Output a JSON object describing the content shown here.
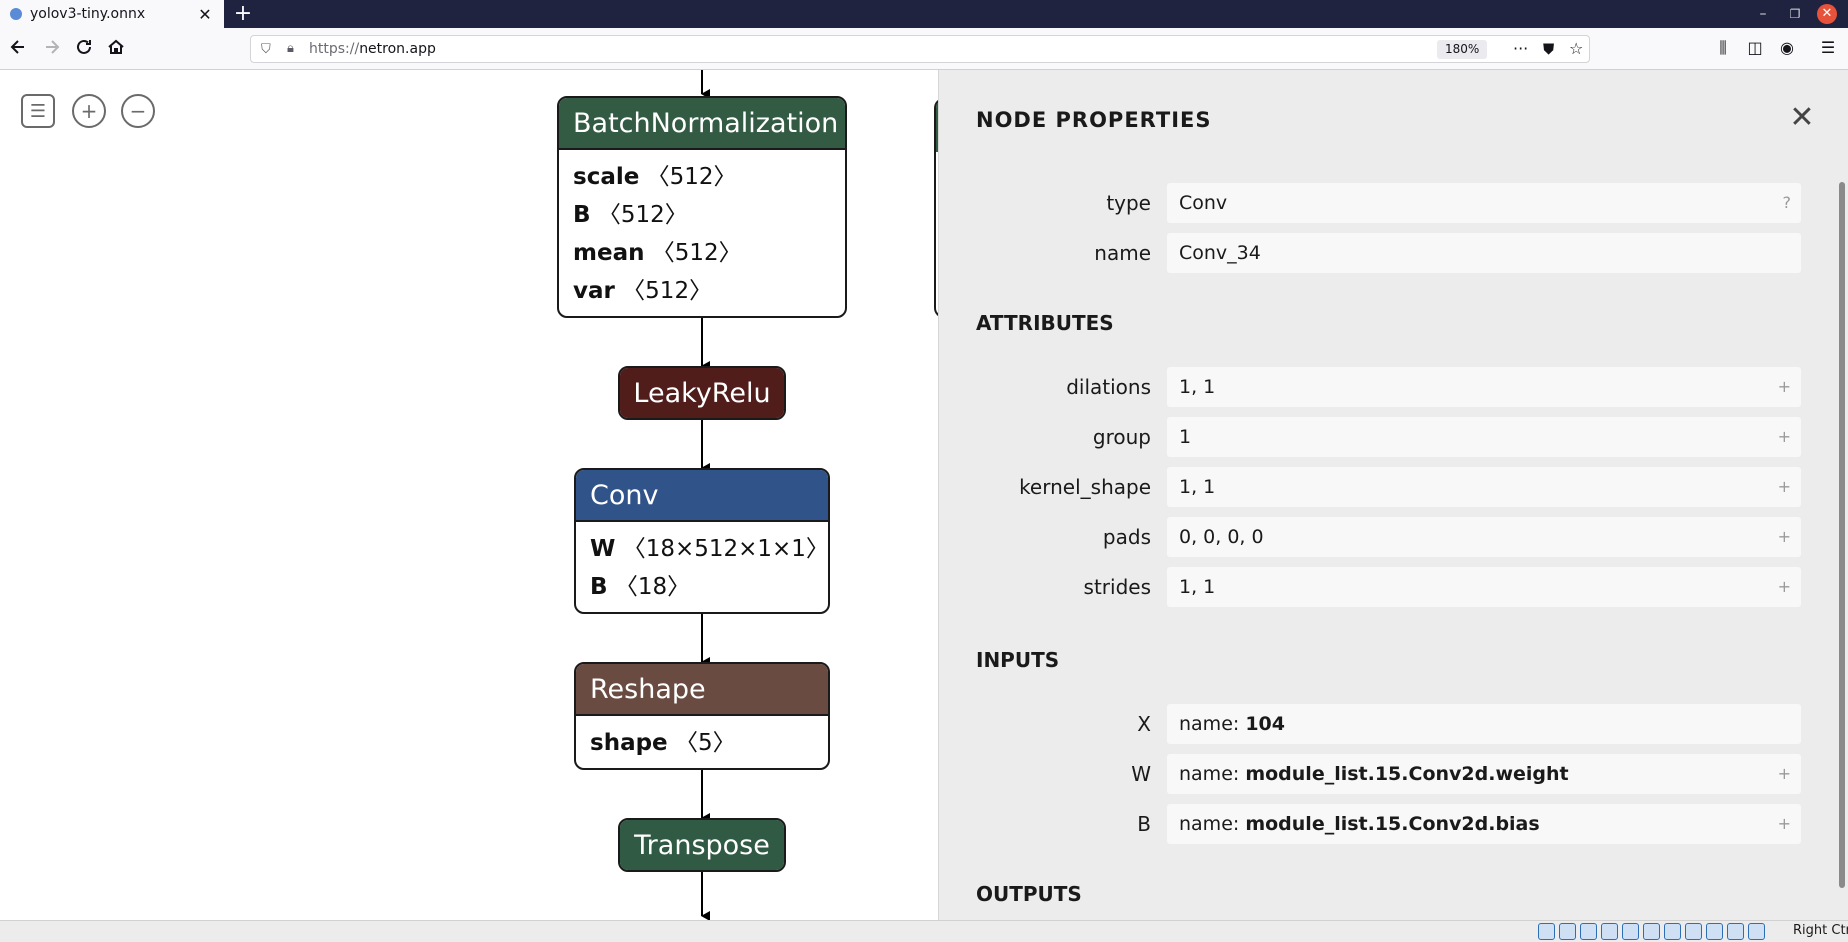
{
  "browser": {
    "tab_title": "yolov3-tiny.onnx",
    "tab_close": "✕",
    "new_tab": "+",
    "url_scheme": "https://",
    "url_host": "netron.app",
    "zoom": "180%",
    "more": "···"
  },
  "toolbar": {
    "menu_icon": "☰",
    "zoom_in_icon": "+",
    "zoom_out_icon": "−"
  },
  "graph": {
    "nodes": [
      {
        "id": "bn",
        "op": "BatchNormalization",
        "attrs": [
          {
            "name": "scale",
            "value": "〈512〉"
          },
          {
            "name": "B",
            "value": "〈512〉"
          },
          {
            "name": "mean",
            "value": "〈512〉"
          },
          {
            "name": "var",
            "value": "〈512〉"
          }
        ]
      },
      {
        "id": "relu",
        "op": "LeakyRelu",
        "attrs": []
      },
      {
        "id": "conv",
        "op": "Conv",
        "attrs": [
          {
            "name": "W",
            "value": "〈18×512×1×1〉"
          },
          {
            "name": "B",
            "value": "〈18〉"
          }
        ]
      },
      {
        "id": "reshape",
        "op": "Reshape",
        "attrs": [
          {
            "name": "shape",
            "value": "〈5〉"
          }
        ]
      },
      {
        "id": "transpose",
        "op": "Transpose",
        "attrs": []
      }
    ]
  },
  "panel": {
    "title": "NODE PROPERTIES",
    "close": "✕",
    "properties": [
      {
        "label": "type",
        "value": "Conv",
        "button": "?"
      },
      {
        "label": "name",
        "value": "Conv_34",
        "button": ""
      }
    ],
    "attributes_heading": "ATTRIBUTES",
    "attributes": [
      {
        "label": "dilations",
        "value": "1, 1",
        "button": "+"
      },
      {
        "label": "group",
        "value": "1",
        "button": "+"
      },
      {
        "label": "kernel_shape",
        "value": "1, 1",
        "button": "+"
      },
      {
        "label": "pads",
        "value": "0, 0, 0, 0",
        "button": "+"
      },
      {
        "label": "strides",
        "value": "1, 1",
        "button": "+"
      }
    ],
    "inputs_heading": "INPUTS",
    "inputs": [
      {
        "label": "X",
        "prefix": "name: ",
        "value": "104",
        "button": ""
      },
      {
        "label": "W",
        "prefix": "name: ",
        "value": "module_list.15.Conv2d.weight",
        "button": "+"
      },
      {
        "label": "B",
        "prefix": "name: ",
        "value": "module_list.15.Conv2d.bias",
        "button": "+"
      }
    ],
    "outputs_heading": "OUTPUTS"
  },
  "statusbar": {
    "host_key": "Right Ctrl"
  }
}
